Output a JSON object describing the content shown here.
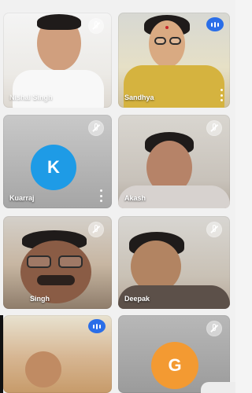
{
  "participants": [
    {
      "name": "Nishal Singh",
      "type": "video",
      "muted": true
    },
    {
      "name": "Sandhya",
      "type": "video",
      "speaking": true,
      "has_menu": true
    },
    {
      "name": "Kuarraj",
      "type": "avatar",
      "avatar_letter": "K",
      "avatar_color": "#1e9be6",
      "muted": true,
      "has_menu": true
    },
    {
      "name": "Akash",
      "type": "video",
      "muted": true
    },
    {
      "name": "Singh",
      "type": "video",
      "muted": true
    },
    {
      "name": "Deepak",
      "type": "video",
      "muted": true
    },
    {
      "name": "",
      "type": "video",
      "speaking": true
    },
    {
      "name": "",
      "type": "avatar",
      "avatar_letter": "G",
      "avatar_color": "#f39a32",
      "muted": true
    }
  ],
  "icons": {
    "muted": "microphone-off-icon",
    "speaking": "speaking-indicator-icon",
    "menu": "more-options-icon"
  },
  "colors": {
    "speaking_indicator": "#2a6ee8",
    "tile_background_gray": "#a5a5a5",
    "page_background": "#f1f1f1"
  }
}
